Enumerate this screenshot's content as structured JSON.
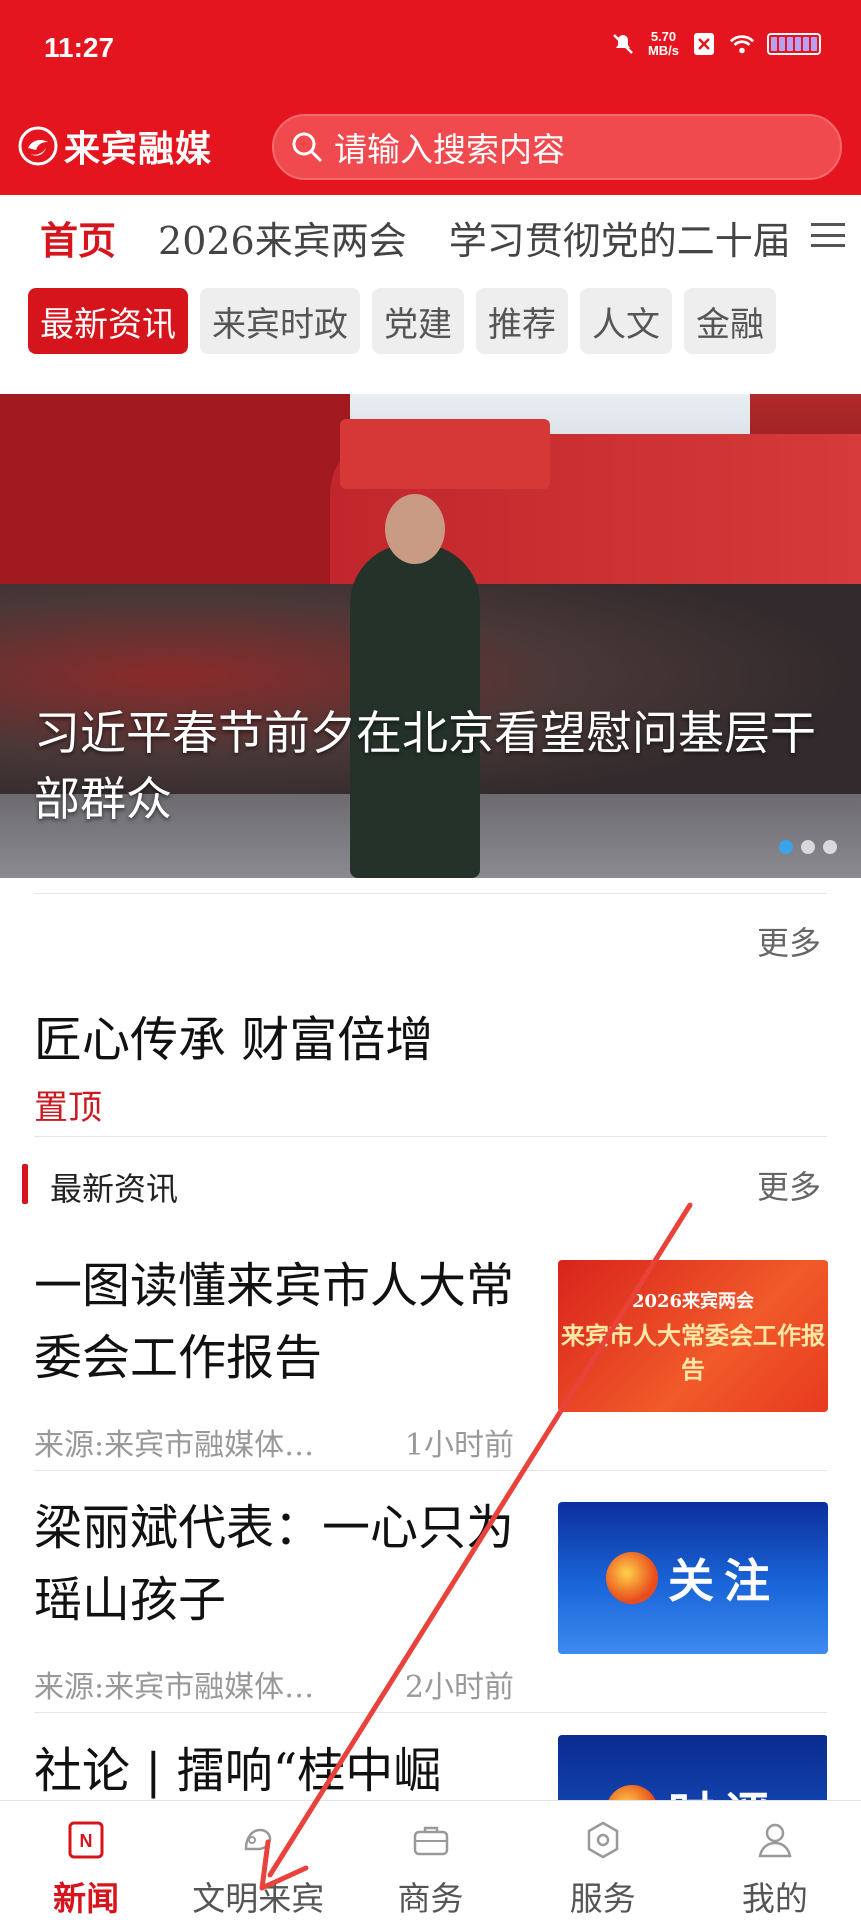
{
  "status_bar": {
    "time": "11:27",
    "net_speed_value": "5.70",
    "net_speed_unit": "MB/s"
  },
  "header": {
    "app_name": "来宾融媒",
    "search_placeholder": "请输入搜索内容"
  },
  "channels": [
    "首页",
    "2026来宾两会",
    "学习贯彻党的二十届"
  ],
  "active_channel": "首页",
  "subtabs": [
    "最新资讯",
    "来宾时政",
    "党建",
    "推荐",
    "人文",
    "金融"
  ],
  "banner": {
    "title": "习近平春节前夕在北京看望慰问基层干部群众",
    "slide_count": 3,
    "active_slide": 1
  },
  "more_label": "更多",
  "pinned": {
    "title": "匠心传承 财富倍增",
    "tag": "置顶"
  },
  "latest_section": {
    "title": "最新资讯",
    "more": "更多"
  },
  "news": [
    {
      "title": "一图读懂来宾市人大常委会工作报告",
      "source": "来源:来宾市融媒体…",
      "time": "1小时前",
      "thumb_text": "来宾市人大常委会工作报告",
      "thumb_header": "2026来宾两会"
    },
    {
      "title": "梁丽斌代表：一心只为瑶山孩子",
      "source": "来源:来宾市融媒体…",
      "time": "2小时前",
      "thumb_text": "关注"
    },
    {
      "title": "社论 | 擂响“桂中崛",
      "thumb_text": "时评"
    }
  ],
  "bottom_nav": [
    {
      "label": "新闻",
      "icon": "news-icon",
      "active": true
    },
    {
      "label": "文明来宾",
      "icon": "civilization-icon",
      "active": false
    },
    {
      "label": "商务",
      "icon": "briefcase-icon",
      "active": false
    },
    {
      "label": "服务",
      "icon": "service-icon",
      "active": false
    },
    {
      "label": "我的",
      "icon": "profile-icon",
      "active": false
    }
  ],
  "colors": {
    "brand_red": "#e4151e",
    "accent_red": "#d6141c",
    "arrow": "#e8423a"
  }
}
